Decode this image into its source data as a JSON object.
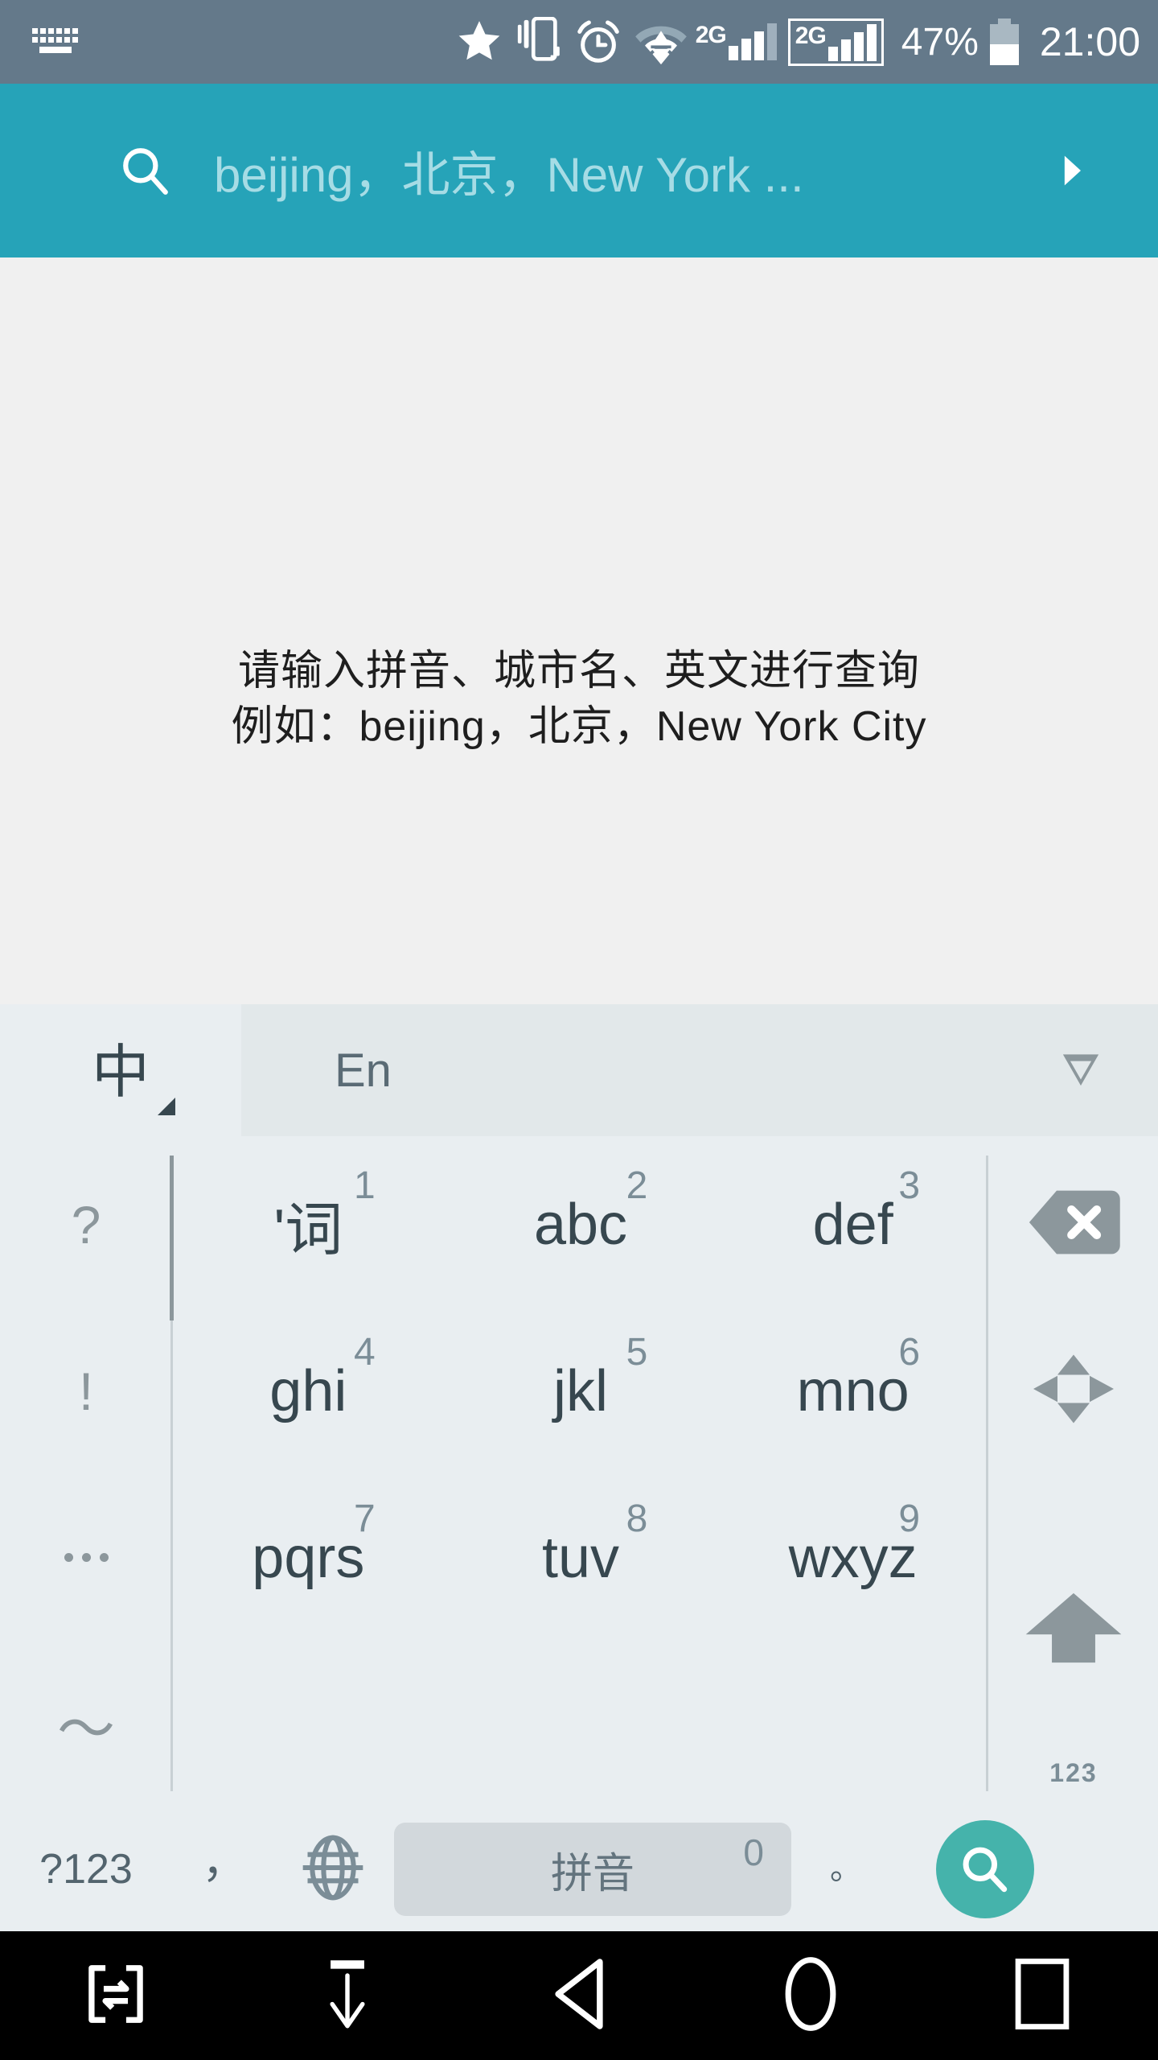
{
  "statusbar": {
    "icons": [
      "keyboard-icon",
      "star-icon",
      "vibrate-icon",
      "alarm-icon",
      "wifi-icon"
    ],
    "sim1_network": "2G",
    "sim2_network": "2G",
    "battery_percent": "47%",
    "clock": "21:00",
    "bg_color": "#64798a"
  },
  "searchbar": {
    "placeholder": "beijing，北京，New York ...",
    "bg_color": "#26a3b8",
    "search_icon": "search-icon",
    "arrow_icon": "chevron-right-icon"
  },
  "content": {
    "hint_line1": "请输入拼音、城市名、英文进行查询",
    "hint_line2": "例如：beijing，北京，New York City",
    "bg_color": "#f0f0f0"
  },
  "keyboard": {
    "lang_key": "中",
    "candidate_label": "En",
    "expand_icon": "triangle-down-icon",
    "symbol_column": [
      "?",
      "!",
      "...",
      "～"
    ],
    "rows": [
      [
        {
          "main": "'词",
          "sub": "1"
        },
        {
          "main": "abc",
          "sub": "2"
        },
        {
          "main": "def",
          "sub": "3"
        }
      ],
      [
        {
          "main": "ghi",
          "sub": "4"
        },
        {
          "main": "jkl",
          "sub": "5"
        },
        {
          "main": "mno",
          "sub": "6"
        }
      ],
      [
        {
          "main": "pqrs",
          "sub": "7"
        },
        {
          "main": "tuv",
          "sub": "8"
        },
        {
          "main": "wxyz",
          "sub": "9"
        }
      ]
    ],
    "function_keys": {
      "backspace": "backspace-icon",
      "cursor_pad": "dpad-icon",
      "shift": "shift-up-icon",
      "shift_label": "123"
    },
    "bottom_row": {
      "symbols_key": "?123",
      "comma_key": "，",
      "globe_key": "globe-icon",
      "space_key": "拼音",
      "space_sub": "0",
      "period_key": "。",
      "search_key": "search-icon"
    },
    "bg_color": "#e9eef1",
    "accent_color": "#45b3ab"
  },
  "navbar": {
    "items": [
      "screenshot-swap-icon",
      "hide-keyboard-icon",
      "back-icon",
      "home-icon",
      "recents-icon"
    ],
    "bg_color": "#000000"
  }
}
